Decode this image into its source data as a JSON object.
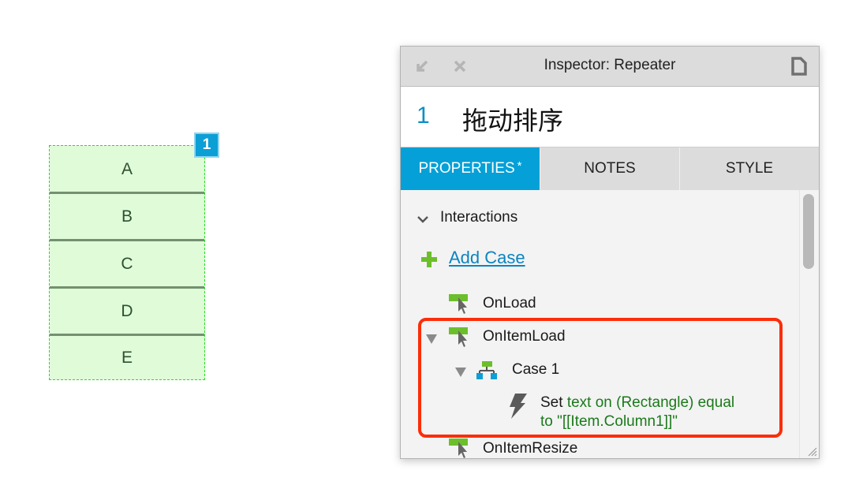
{
  "repeater": {
    "rows": [
      "A",
      "B",
      "C",
      "D",
      "E"
    ],
    "badge": "1",
    "colors": {
      "fill": "#dffbd8",
      "border": "#22e022",
      "separator": "#739070",
      "badge": "#0b9fd6"
    }
  },
  "inspector": {
    "title": "Inspector: Repeater",
    "widget_number": "1",
    "widget_name": "拖动排序",
    "tabs": [
      {
        "label": "PROPERTIES",
        "marker": "*",
        "active": true
      },
      {
        "label": "NOTES",
        "active": false
      },
      {
        "label": "STYLE",
        "active": false
      }
    ],
    "section": {
      "label": "Interactions",
      "expanded": true
    },
    "add_case_label": "Add Case",
    "events": [
      {
        "label": "OnLoad",
        "expanded": false
      },
      {
        "label": "OnItemLoad",
        "expanded": true,
        "cases": [
          {
            "label": "Case 1",
            "expanded": true,
            "actions": [
              {
                "verb": "Set",
                "detail_line1": "text on (Rectangle) equal",
                "detail_line2": "to \"[[Item.Column1]]\""
              }
            ]
          }
        ]
      },
      {
        "label": "OnItemResize",
        "expanded": false
      }
    ],
    "colors": {
      "accent": "#05a0d7",
      "link": "#0b84c0",
      "action_detail": "#1a7a1a",
      "highlight": "#fb2d0a",
      "icon_green": "#6cbf2b"
    }
  }
}
